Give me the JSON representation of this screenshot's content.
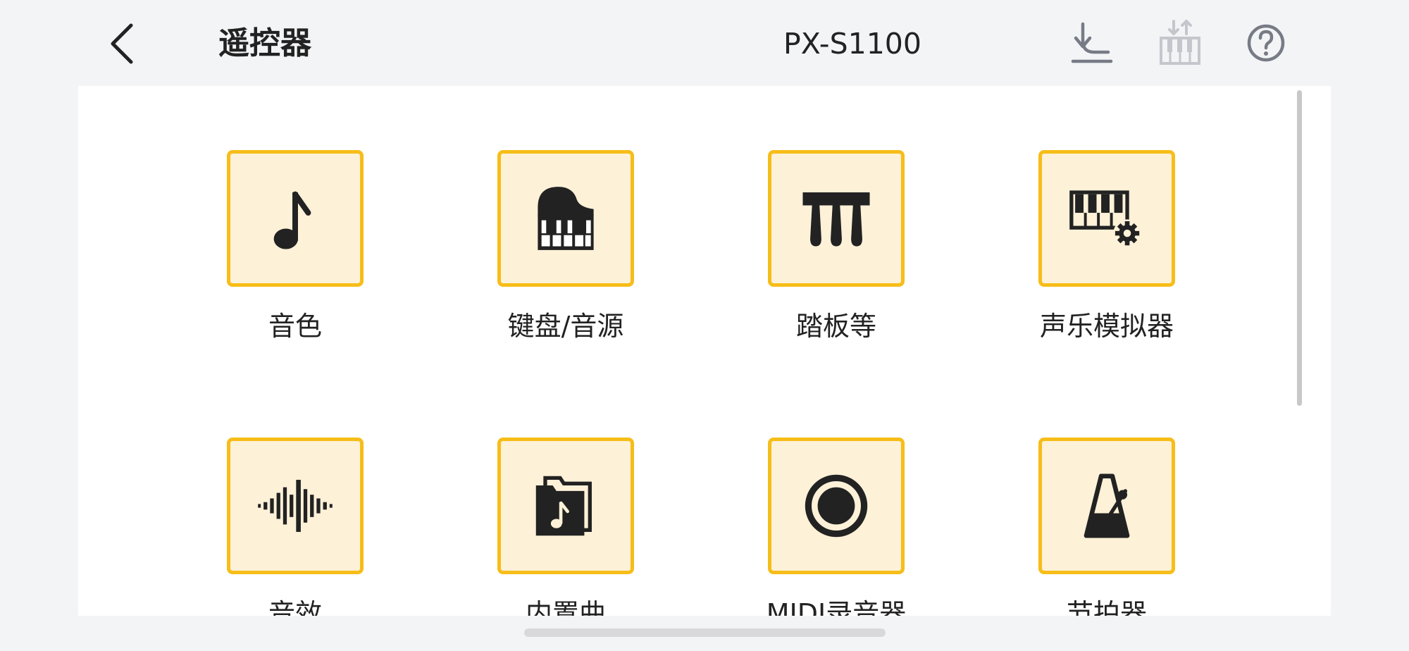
{
  "header": {
    "back_icon": "chevron-left-icon",
    "title": "遥控器",
    "device": "PX-S1100",
    "actions": [
      {
        "icon": "download-icon",
        "enabled": true
      },
      {
        "icon": "keyboard-transfer-icon",
        "enabled": false
      },
      {
        "icon": "help-icon",
        "enabled": true
      }
    ]
  },
  "colors": {
    "accent": "#f7bd18",
    "tile_fill": "#fdf1d8",
    "icon": "#222222",
    "background": "#f3f4f6",
    "disabled_icon": "#c4c6cc"
  },
  "grid": {
    "items": [
      {
        "label": "音色",
        "icon": "music-note-icon"
      },
      {
        "label": "键盘/音源",
        "icon": "grand-piano-icon"
      },
      {
        "label": "踏板等",
        "icon": "pedals-icon"
      },
      {
        "label": "声乐模拟器",
        "icon": "keyboard-settings-icon"
      },
      {
        "label": "音效",
        "icon": "waveform-icon"
      },
      {
        "label": "内置曲",
        "icon": "music-folder-icon"
      },
      {
        "label": "MIDI录音器",
        "icon": "record-icon"
      },
      {
        "label": "节拍器",
        "icon": "metronome-icon"
      }
    ]
  }
}
